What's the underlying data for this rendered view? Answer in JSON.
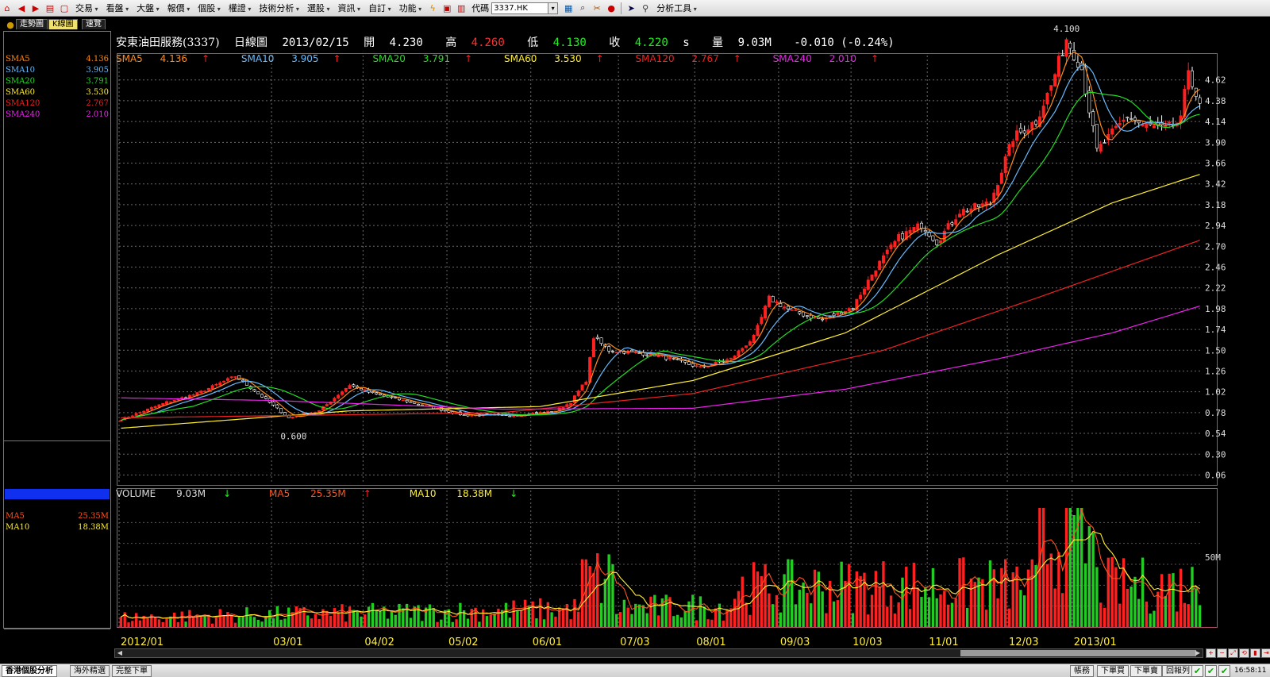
{
  "toolbar": {
    "menus": [
      "交易",
      "看盤",
      "大盤",
      "報價",
      "個股",
      "權證",
      "技術分析",
      "選股",
      "資訊",
      "自訂",
      "功能"
    ],
    "code_label": "代碼",
    "code_value": "3337.HK",
    "analysis_tools": "分析工具"
  },
  "tabs": [
    "走勢圖",
    "K線圖",
    "速覽"
  ],
  "header": {
    "name": "安東油田服務(3337)",
    "period": "日線圖",
    "date": "2013/02/15",
    "open_label": "開",
    "open": "4.230",
    "high_label": "高",
    "high": "4.260",
    "low_label": "低",
    "low": "4.130",
    "close_label": "收",
    "close": "4.220",
    "close_suffix": "s",
    "vol_label": "量",
    "volume": "9.03M",
    "change": "-0.010 (-0.24%)"
  },
  "ma_legend": [
    {
      "name": "SMA5",
      "value": "4.136",
      "color": "#ff8c1a"
    },
    {
      "name": "SMA10",
      "value": "3.905",
      "color": "#66bbff"
    },
    {
      "name": "SMA20",
      "value": "3.791",
      "color": "#22dd22"
    },
    {
      "name": "SMA60",
      "value": "3.530",
      "color": "#ffee33"
    },
    {
      "name": "SMA120",
      "value": "2.767",
      "color": "#ee2222"
    },
    {
      "name": "SMA240",
      "value": "2.010",
      "color": "#ee22ee"
    }
  ],
  "vol_legend": [
    {
      "name": "VOLUME",
      "value": "9.03M",
      "color": "#dddddd"
    },
    {
      "name": "MA5",
      "value": "25.35M",
      "color": "#ff5522"
    },
    {
      "name": "MA10",
      "value": "18.38M",
      "color": "#ffee33"
    }
  ],
  "price_annotations": {
    "high": "4.100",
    "low": "0.600"
  },
  "vol_scale_label": "50M",
  "status": {
    "tabs": [
      "香港個股分析",
      "海外精選",
      "完整下單"
    ],
    "right_buttons": [
      "帳務",
      "下單買",
      "下單賣",
      "回報列"
    ],
    "time": "16:58:11"
  },
  "chart_data": {
    "type": "candlestick",
    "price_axis": {
      "ticks": [
        "4.62",
        "4.38",
        "4.14",
        "3.90",
        "3.66",
        "3.42",
        "3.18",
        "2.94",
        "2.70",
        "2.46",
        "2.22",
        "1.98",
        "1.74",
        "1.50",
        "1.26",
        "1.02",
        "0.78",
        "0.54",
        "0.30",
        "0.06"
      ],
      "range": [
        0.0,
        4.7
      ]
    },
    "x_ticks": [
      "2012/01",
      "03/01",
      "04/02",
      "05/02",
      "06/01",
      "07/03",
      "08/01",
      "09/03",
      "10/03",
      "11/01",
      "12/03",
      "2013/01"
    ],
    "x_tick_index": [
      0,
      40,
      64,
      86,
      108,
      131,
      151,
      173,
      192,
      212,
      233,
      250
    ],
    "series": [
      {
        "name": "SMA5",
        "color": "#ff8c1a"
      },
      {
        "name": "SMA10",
        "color": "#66bbff"
      },
      {
        "name": "SMA20",
        "color": "#22dd22"
      },
      {
        "name": "SMA60",
        "color": "#ffee33"
      },
      {
        "name": "SMA120",
        "color": "#ee2222"
      },
      {
        "name": "SMA240",
        "color": "#ee22ee"
      }
    ],
    "close_anchors": [
      [
        0,
        0.7
      ],
      [
        12,
        0.9
      ],
      [
        20,
        1.0
      ],
      [
        30,
        1.2
      ],
      [
        36,
        1.0
      ],
      [
        44,
        0.72
      ],
      [
        52,
        0.8
      ],
      [
        60,
        1.1
      ],
      [
        66,
        1.0
      ],
      [
        76,
        0.9
      ],
      [
        90,
        0.75
      ],
      [
        104,
        0.75
      ],
      [
        114,
        0.8
      ],
      [
        118,
        0.9
      ],
      [
        122,
        1.15
      ],
      [
        124,
        1.65
      ],
      [
        128,
        1.5
      ],
      [
        140,
        1.45
      ],
      [
        152,
        1.3
      ],
      [
        160,
        1.4
      ],
      [
        166,
        1.65
      ],
      [
        170,
        2.1
      ],
      [
        176,
        1.95
      ],
      [
        184,
        1.85
      ],
      [
        192,
        2.0
      ],
      [
        198,
        2.45
      ],
      [
        204,
        2.8
      ],
      [
        210,
        2.95
      ],
      [
        214,
        2.75
      ],
      [
        220,
        3.1
      ],
      [
        228,
        3.2
      ],
      [
        234,
        3.95
      ],
      [
        240,
        4.15
      ],
      [
        244,
        4.55
      ],
      [
        248,
        5.1
      ],
      [
        252,
        4.75
      ],
      [
        256,
        3.8
      ],
      [
        260,
        4.0
      ],
      [
        264,
        4.2
      ],
      [
        268,
        4.1
      ],
      [
        274,
        4.05
      ],
      [
        278,
        4.15
      ],
      [
        280,
        4.75
      ],
      [
        283,
        4.3
      ]
    ],
    "sma60_anchors": [
      [
        0,
        0.6
      ],
      [
        60,
        0.8
      ],
      [
        110,
        0.85
      ],
      [
        150,
        1.15
      ],
      [
        190,
        1.7
      ],
      [
        230,
        2.6
      ],
      [
        260,
        3.2
      ],
      [
        283,
        3.53
      ]
    ],
    "sma120_anchors": [
      [
        0,
        0.72
      ],
      [
        100,
        0.78
      ],
      [
        150,
        1.0
      ],
      [
        200,
        1.5
      ],
      [
        240,
        2.1
      ],
      [
        283,
        2.77
      ]
    ],
    "sma240_anchors": [
      [
        0,
        0.95
      ],
      [
        40,
        0.92
      ],
      [
        100,
        0.82
      ],
      [
        150,
        0.83
      ],
      [
        190,
        1.05
      ],
      [
        230,
        1.4
      ],
      [
        260,
        1.7
      ],
      [
        283,
        2.01
      ]
    ]
  }
}
